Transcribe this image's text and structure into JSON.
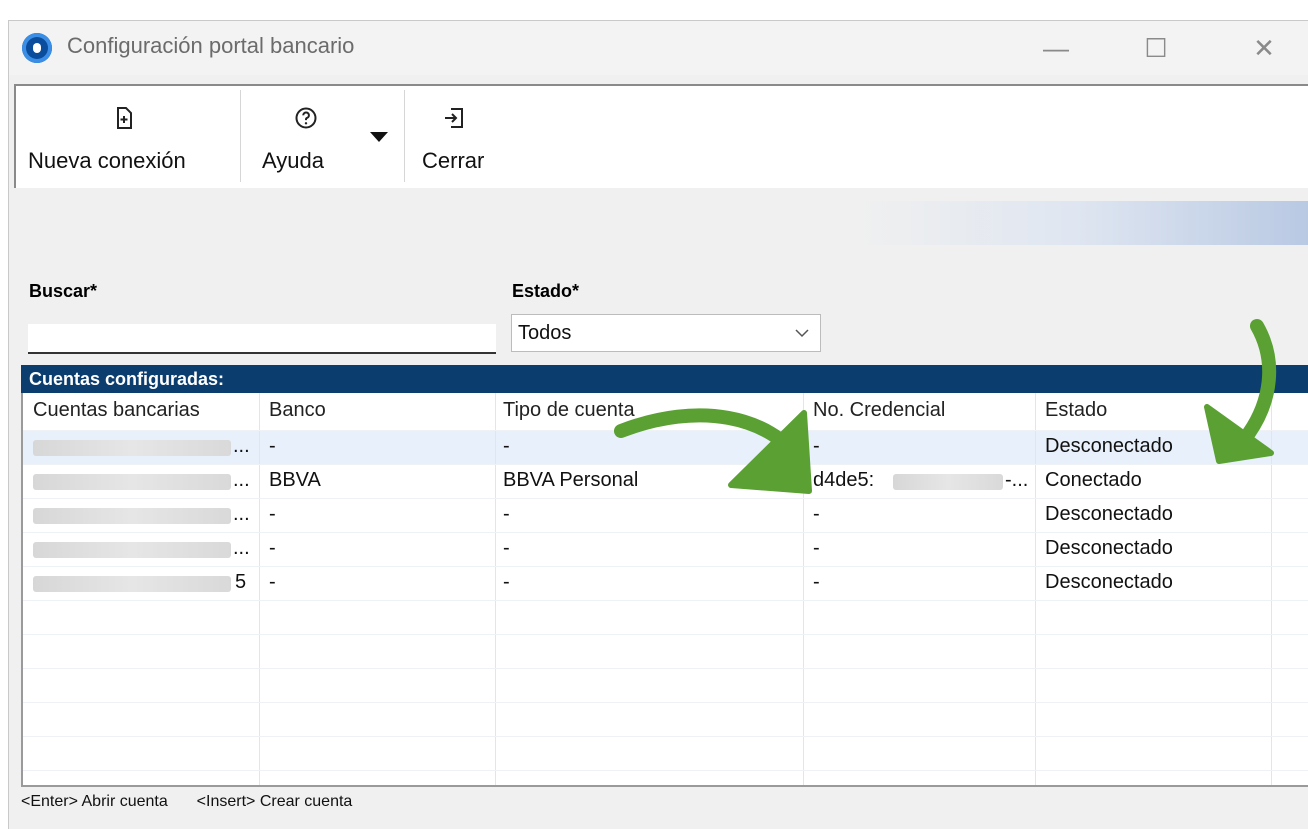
{
  "window": {
    "title": "Configuración portal bancario",
    "controls": {
      "minimize": "—",
      "maximize": "☐",
      "close": "✕"
    }
  },
  "toolbar": {
    "new_connection": "Nueva conexión",
    "help": "Ayuda",
    "close": "Cerrar"
  },
  "filters": {
    "search_label": "Buscar*",
    "search_value": "",
    "state_label": "Estado*",
    "state_value": "Todos"
  },
  "section": {
    "title": "Cuentas configuradas:"
  },
  "table": {
    "headers": [
      "Cuentas bancarias",
      "Banco",
      "Tipo de cuenta",
      "No. Credencial",
      "Estado"
    ],
    "rows": [
      {
        "account_suffix": "...",
        "bank": "-",
        "type": "-",
        "credential": "-",
        "credential_suffix": "",
        "state": "Desconectado"
      },
      {
        "account_suffix": "...",
        "bank": "BBVA",
        "type": "BBVA Personal",
        "credential": "d4de5:",
        "credential_suffix": "-...",
        "state": "Conectado"
      },
      {
        "account_suffix": "...",
        "bank": "-",
        "type": "-",
        "credential": "-",
        "credential_suffix": "",
        "state": "Desconectado"
      },
      {
        "account_suffix": "...",
        "bank": "-",
        "type": "-",
        "credential": "-",
        "credential_suffix": "",
        "state": "Desconectado"
      },
      {
        "account_suffix": "5",
        "bank": "-",
        "type": "-",
        "credential": "-",
        "credential_suffix": "",
        "state": "Desconectado"
      }
    ]
  },
  "statusbar": {
    "hint1": "<Enter> Abrir cuenta",
    "hint2": "<Insert> Crear cuenta"
  },
  "colors": {
    "section_header": "#0b3d6e",
    "annotation_arrow": "#5aa033",
    "selected_row": "#e7f0fb"
  },
  "icons": {
    "app": "bank-portal-app-icon",
    "new_connection": "file-plus-icon",
    "help": "question-circle-icon",
    "close": "exit-icon",
    "dropdown": "caret-down-icon"
  }
}
